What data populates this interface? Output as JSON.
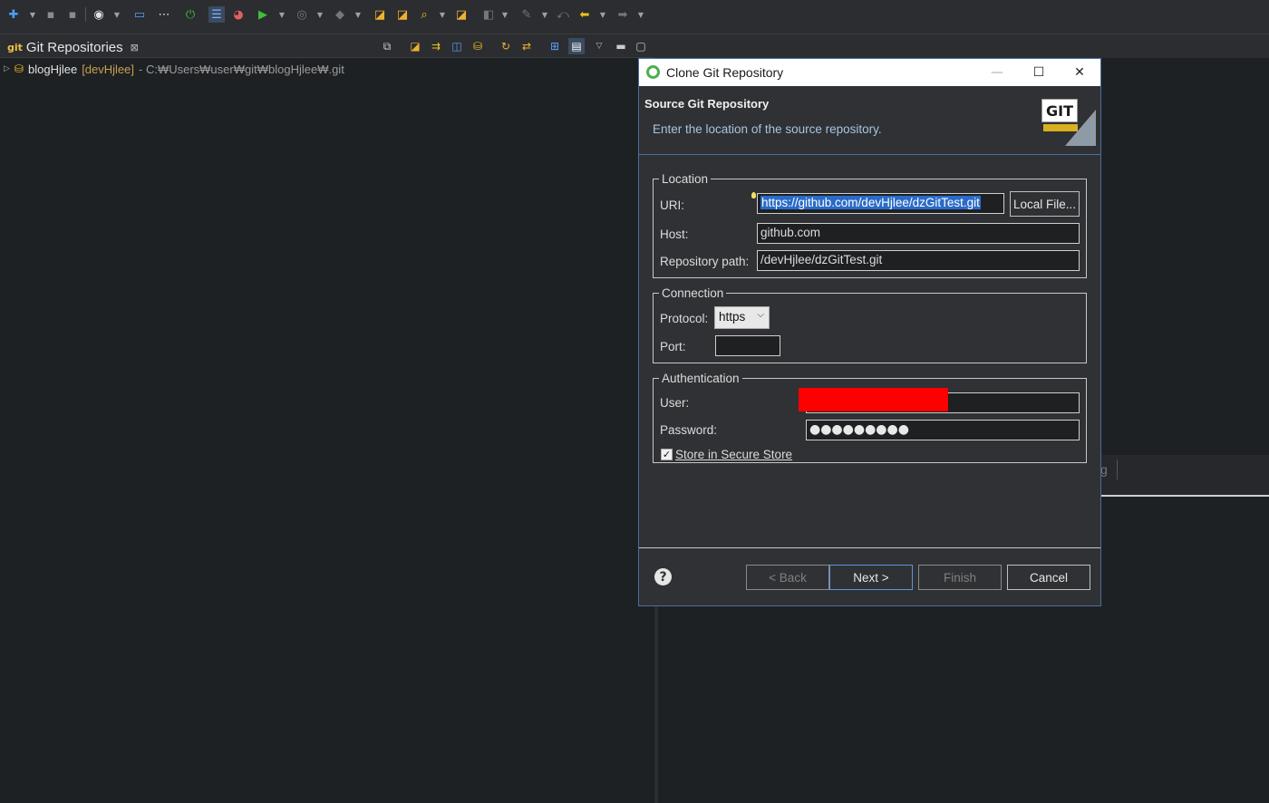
{
  "toolbar": {
    "icons": [
      "new-icon",
      "save-icon",
      "save-all-icon",
      "user-icon",
      "monitor-icon",
      "debug-icon",
      "power-icon",
      "tasks-icon",
      "chart-icon",
      "run-icon",
      "stop-icon",
      "external-icon",
      "open-type-icon",
      "open-resource-icon",
      "search-icon",
      "folder-icon",
      "annotation-icon",
      "edit-icon",
      "back-icon",
      "forward-icon"
    ]
  },
  "git_view": {
    "tab_icon": "git",
    "tab_title": "Git Repositories",
    "close_glyph": "⊠",
    "repos": [
      {
        "name": "blogHjlee",
        "branch": "[devHjlee]",
        "path": "- C:₩Users₩user₩git₩blogHjlee₩.git"
      }
    ]
  },
  "right_tab": {
    "label": "g"
  },
  "dialog": {
    "title": "Clone Git Repository",
    "window_controls": {
      "minimize": "—",
      "maximize": "☐",
      "close": "✕"
    },
    "header_title": "Source Git Repository",
    "header_message": "Enter the location of the source repository.",
    "logo_text": "GIT",
    "location": {
      "legend": "Location",
      "uri_label": "URI:",
      "uri_value": "https://github.com/devHjlee/dzGitTest.git",
      "local_file_button": "Local File...",
      "host_label": "Host:",
      "host_value": "github.com",
      "repo_path_label": "Repository path:",
      "repo_path_value": "/devHjlee/dzGitTest.git"
    },
    "connection": {
      "legend": "Connection",
      "protocol_label": "Protocol:",
      "protocol_value": "https",
      "port_label": "Port:",
      "port_value": ""
    },
    "authentication": {
      "legend": "Authentication",
      "user_label": "User:",
      "password_label": "Password:",
      "password_mask": "●●●●●●●●●",
      "store_label": "Store in Secure Store",
      "store_checked": true
    },
    "buttons": {
      "help": "?",
      "back": "< Back",
      "next": "Next >",
      "finish": "Finish",
      "cancel": "Cancel"
    }
  }
}
